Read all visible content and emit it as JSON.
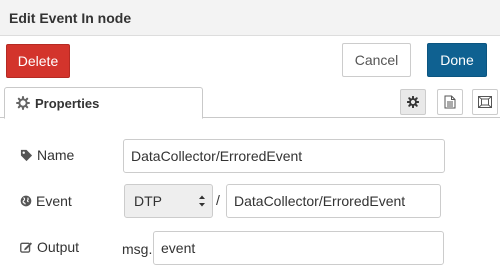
{
  "dialog": {
    "title": "Edit Event In node",
    "delete_label": "Delete",
    "cancel_label": "Cancel",
    "done_label": "Done"
  },
  "tabs": {
    "properties_label": "Properties",
    "icons": [
      "gear-icon",
      "document-icon",
      "frame-icon"
    ]
  },
  "form": {
    "name": {
      "label": "Name",
      "value": "DataCollector/ErroredEvent",
      "icon": "tag-icon"
    },
    "event": {
      "label": "Event",
      "select_value": "DTP",
      "separator": "/",
      "value": "DataCollector/ErroredEvent",
      "icon": "globe-icon"
    },
    "output": {
      "label": "Output",
      "prefix": "msg.",
      "value": "event",
      "icon": "edit-icon"
    }
  },
  "colors": {
    "delete": "#d3342c",
    "done": "#0f6191",
    "titlebar": "#f3f3f3"
  }
}
